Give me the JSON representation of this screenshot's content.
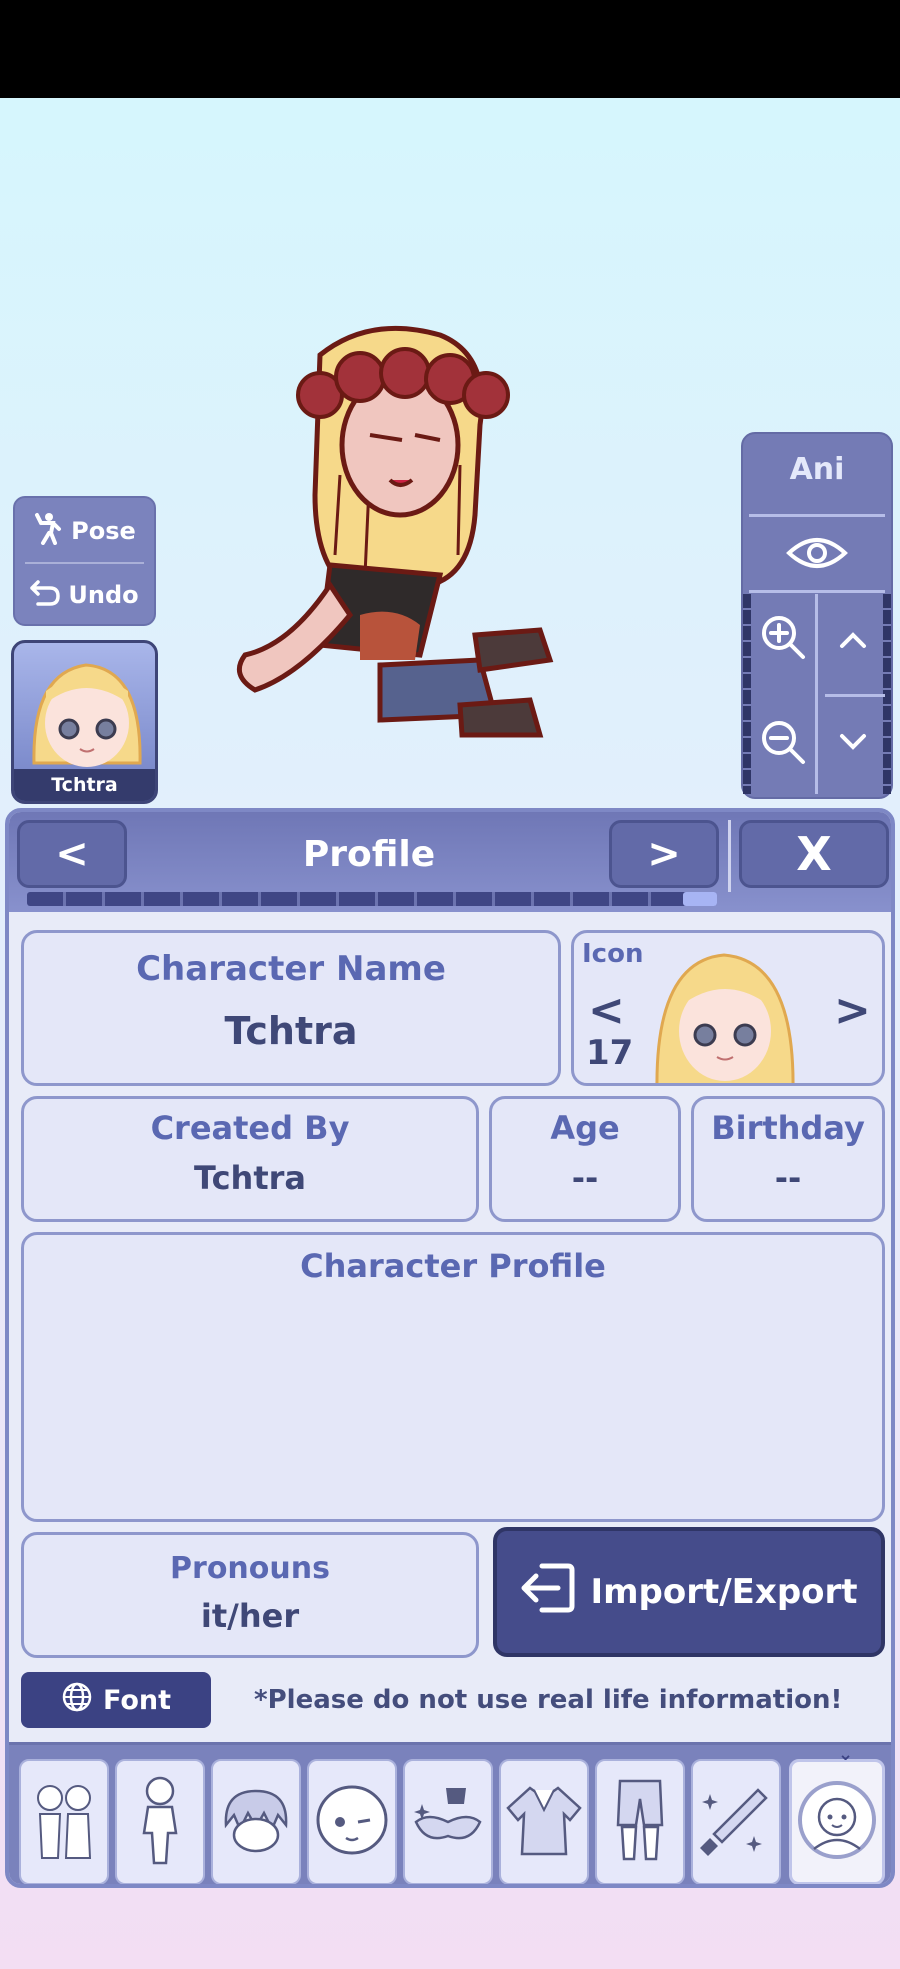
{
  "toolbar": {
    "pose_label": "Pose",
    "undo_label": "Undo",
    "icon_card_label": "Tchtra"
  },
  "camera": {
    "ani_label": "Ani"
  },
  "panel": {
    "title": "Profile",
    "prev_label": "<",
    "next_label": ">",
    "close_label": "X",
    "progress_fraction": 0.95
  },
  "profile": {
    "character_name_label": "Character Name",
    "character_name_value": "Tchtra",
    "icon_label": "Icon",
    "icon_prev": "<",
    "icon_next": ">",
    "icon_number": "17",
    "created_by_label": "Created By",
    "created_by_value": "Tchtra",
    "age_label": "Age",
    "age_value": "--",
    "birthday_label": "Birthday",
    "birthday_value": "--",
    "character_profile_label": "Character Profile",
    "character_profile_value": "",
    "pronouns_label": "Pronouns",
    "pronouns_value": "it/her",
    "import_export_label": "Import/Export",
    "font_label": "Font",
    "warning": "*Please do not use real life information!"
  },
  "categories": [
    {
      "icon": "characters-icon",
      "selected": false
    },
    {
      "icon": "body-icon",
      "selected": false
    },
    {
      "icon": "hair-icon",
      "selected": false
    },
    {
      "icon": "face-icon",
      "selected": false
    },
    {
      "icon": "accessories-icon",
      "selected": false
    },
    {
      "icon": "top-icon",
      "selected": false
    },
    {
      "icon": "bottom-icon",
      "selected": false
    },
    {
      "icon": "props-icon",
      "selected": false
    },
    {
      "icon": "profile-icon",
      "selected": true
    }
  ],
  "colors": {
    "panel_accent": "#6f77b6",
    "dark_button": "#454c8b",
    "text_blue": "#5a68b2"
  }
}
